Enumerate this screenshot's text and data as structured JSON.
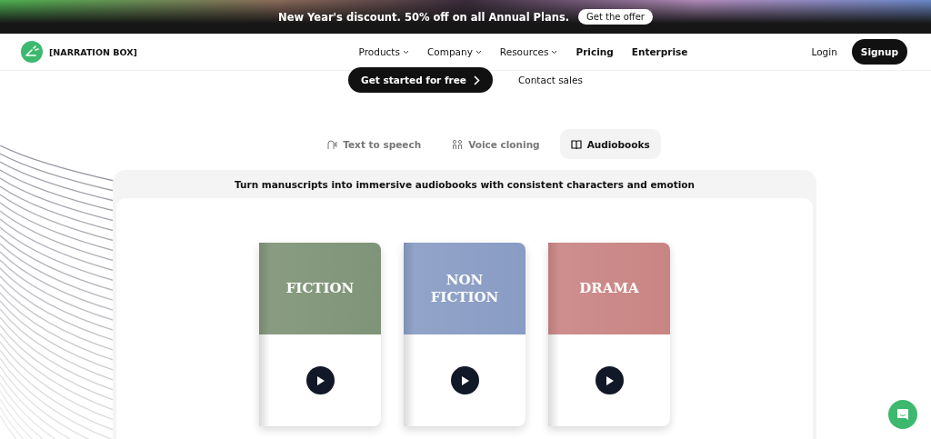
{
  "banner": {
    "text": "New Year's discount. 50% off on all Annual Plans.",
    "button": "Get the offer"
  },
  "nav": {
    "logo": "[NARRATION BOX]",
    "items": [
      {
        "label": "Products",
        "dropdown": true
      },
      {
        "label": "Company",
        "dropdown": true
      },
      {
        "label": "Resources",
        "dropdown": true
      },
      {
        "label": "Pricing",
        "dropdown": false
      },
      {
        "label": "Enterprise",
        "dropdown": false
      }
    ],
    "login": "Login",
    "signup": "Signup"
  },
  "hero": {
    "primary": "Get started for free",
    "secondary": "Contact sales"
  },
  "tabs": [
    {
      "label": "Text to speech",
      "kind": "speech",
      "selected": false
    },
    {
      "label": "Voice cloning",
      "kind": "cloning",
      "selected": false
    },
    {
      "label": "Audiobooks",
      "kind": "book",
      "selected": true
    }
  ],
  "panel": {
    "title": "Turn manuscripts into immersive audiobooks with consistent characters and emotion",
    "books": [
      {
        "title": "FICTION",
        "color": "#7f9478"
      },
      {
        "title": "NON FICTION",
        "color": "#899cc4"
      },
      {
        "title": "DRAMA",
        "color": "#c98584"
      }
    ]
  }
}
